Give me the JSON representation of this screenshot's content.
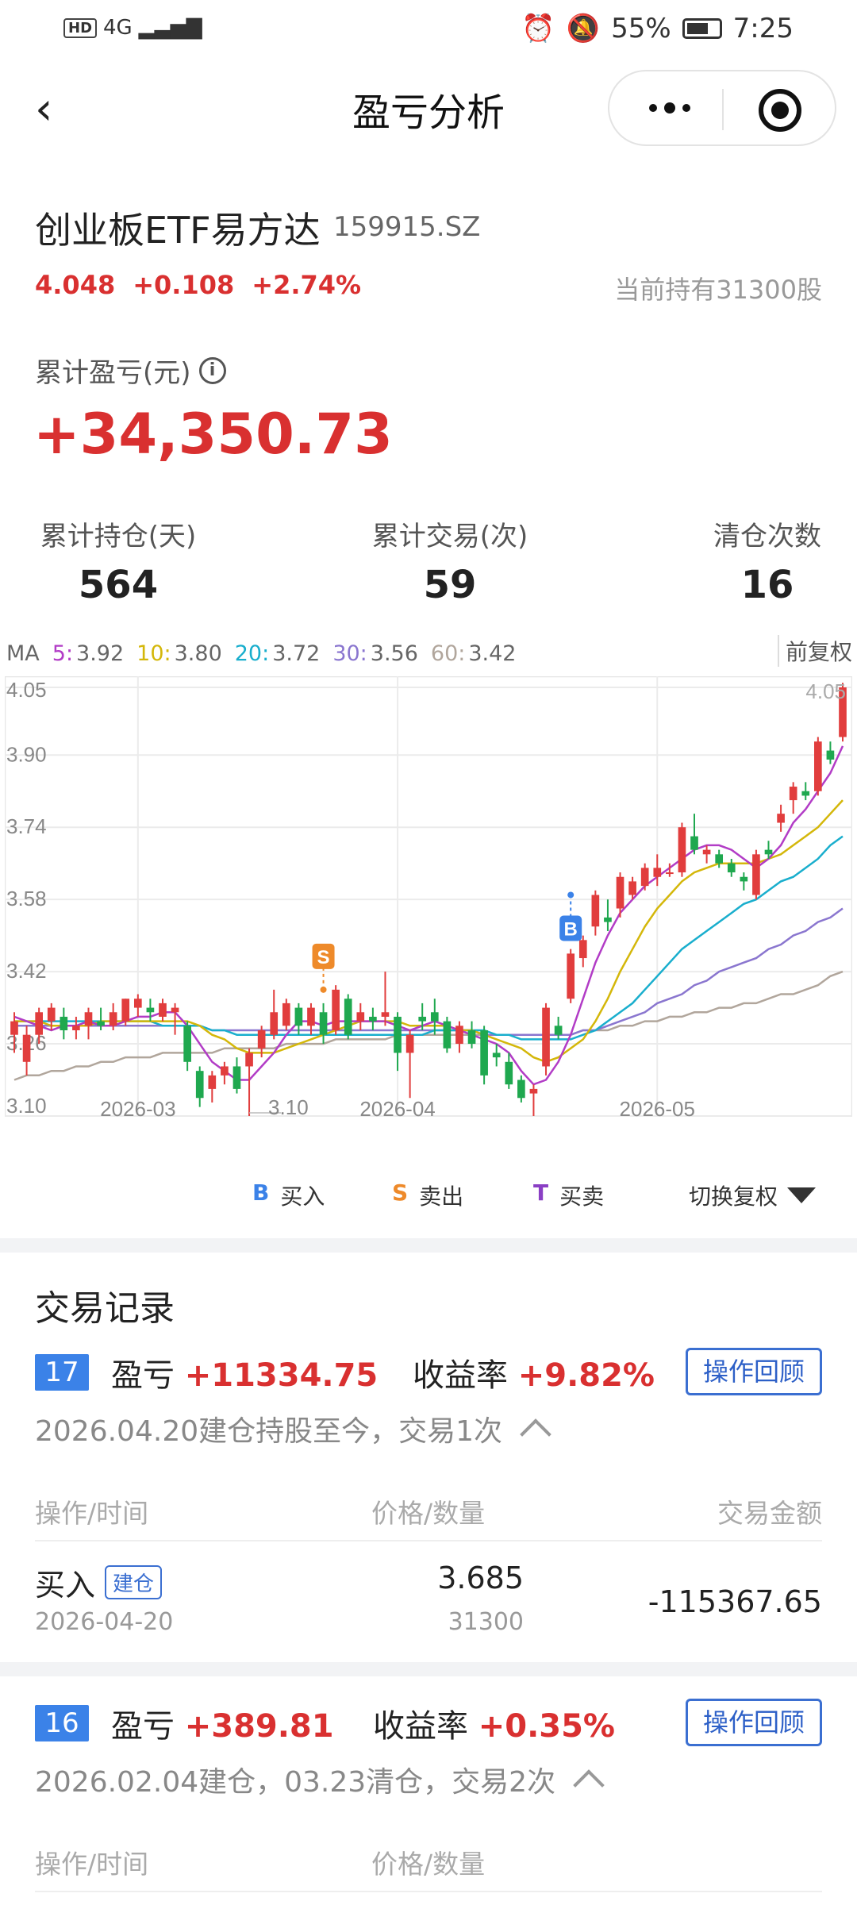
{
  "status_bar": {
    "hd": "HD",
    "network": "4G",
    "battery": "55%",
    "time": "7:25"
  },
  "nav": {
    "title": "盈亏分析",
    "back_icon": "chevron-left-icon",
    "more_icon": "more-dots-icon",
    "close_icon": "target-circle-icon"
  },
  "stock": {
    "name": "创业板ETF易方达",
    "code": "159915.SZ",
    "price": "4.048",
    "change": "+0.108",
    "change_pct": "+2.74%",
    "holding": "当前持有31300股"
  },
  "cumulative": {
    "label": "累计盈亏(元)",
    "value": "+34,350.73"
  },
  "stats": [
    {
      "label": "累计持仓(天)",
      "value": "564"
    },
    {
      "label": "累计交易(次)",
      "value": "59"
    },
    {
      "label": "清仓次数",
      "value": "16"
    }
  ],
  "ma": {
    "prefix": "MA",
    "items": [
      {
        "key": "5:",
        "value": "3.92",
        "color": "#b23cc6"
      },
      {
        "key": "10:",
        "value": "3.80",
        "color": "#d4b70a"
      },
      {
        "key": "20:",
        "value": "3.72",
        "color": "#19aecd"
      },
      {
        "key": "30:",
        "value": "3.56",
        "color": "#8a76cf"
      },
      {
        "key": "60:",
        "value": "3.42",
        "color": "#b1a69c"
      }
    ],
    "adjust_tag": "前复权"
  },
  "chart_data": {
    "type": "candlestick",
    "y_ticks": [
      "4.05",
      "3.90",
      "3.74",
      "3.58",
      "3.42",
      "3.26",
      "3.10"
    ],
    "ylim": [
      3.1,
      4.05
    ],
    "x_ticks": [
      "2026-03",
      "2026-04",
      "2026-05"
    ],
    "max_label": "4.05",
    "min_label": "3.10",
    "up_color": "#e13d3d",
    "down_color": "#1fa84f",
    "candles": [
      [
        3.28,
        3.31,
        3.25,
        3.24,
        3.33
      ],
      [
        3.22,
        3.28,
        3.21,
        3.19,
        3.3
      ],
      [
        3.28,
        3.33,
        3.27,
        3.26,
        3.34
      ],
      [
        3.31,
        3.34,
        3.3,
        3.29,
        3.35
      ],
      [
        3.32,
        3.29,
        3.33,
        3.27,
        3.34
      ],
      [
        3.29,
        3.3,
        3.28,
        3.27,
        3.32
      ],
      [
        3.3,
        3.33,
        3.28,
        3.27,
        3.34
      ],
      [
        3.31,
        3.3,
        3.33,
        3.29,
        3.34
      ],
      [
        3.3,
        3.33,
        3.3,
        3.29,
        3.35
      ],
      [
        3.31,
        3.36,
        3.3,
        3.3,
        3.36
      ],
      [
        3.34,
        3.36,
        3.33,
        3.32,
        3.37
      ],
      [
        3.34,
        3.33,
        3.35,
        3.31,
        3.36
      ],
      [
        3.32,
        3.35,
        3.32,
        3.31,
        3.36
      ],
      [
        3.33,
        3.34,
        3.29,
        3.28,
        3.35
      ],
      [
        3.3,
        3.22,
        3.3,
        3.2,
        3.31
      ],
      [
        3.2,
        3.14,
        3.2,
        3.12,
        3.21
      ],
      [
        3.16,
        3.19,
        3.15,
        3.13,
        3.2
      ],
      [
        3.19,
        3.21,
        3.18,
        3.17,
        3.22
      ],
      [
        3.21,
        3.16,
        3.21,
        3.15,
        3.23
      ],
      [
        3.21,
        3.24,
        3.2,
        3.1,
        3.25
      ],
      [
        3.25,
        3.29,
        3.24,
        3.23,
        3.3
      ],
      [
        3.28,
        3.33,
        3.28,
        3.27,
        3.38
      ],
      [
        3.3,
        3.35,
        3.3,
        3.29,
        3.36
      ],
      [
        3.34,
        3.3,
        3.34,
        3.28,
        3.35
      ],
      [
        3.3,
        3.34,
        3.29,
        3.28,
        3.35
      ],
      [
        3.33,
        3.28,
        3.33,
        3.26,
        3.35
      ],
      [
        3.29,
        3.38,
        3.29,
        3.28,
        3.39
      ],
      [
        3.36,
        3.28,
        3.36,
        3.27,
        3.37
      ],
      [
        3.31,
        3.33,
        3.3,
        3.29,
        3.35
      ],
      [
        3.32,
        3.31,
        3.33,
        3.29,
        3.34
      ],
      [
        3.32,
        3.33,
        3.31,
        3.3,
        3.42
      ],
      [
        3.32,
        3.24,
        3.32,
        3.2,
        3.33
      ],
      [
        3.24,
        3.28,
        3.23,
        3.14,
        3.29
      ],
      [
        3.32,
        3.31,
        3.33,
        3.29,
        3.35
      ],
      [
        3.33,
        3.31,
        3.33,
        3.28,
        3.36
      ],
      [
        3.31,
        3.25,
        3.31,
        3.24,
        3.32
      ],
      [
        3.26,
        3.3,
        3.25,
        3.24,
        3.31
      ],
      [
        3.29,
        3.26,
        3.29,
        3.25,
        3.31
      ],
      [
        3.29,
        3.19,
        3.29,
        3.17,
        3.3
      ],
      [
        3.24,
        3.23,
        3.25,
        3.21,
        3.26
      ],
      [
        3.22,
        3.17,
        3.22,
        3.16,
        3.24
      ],
      [
        3.18,
        3.14,
        3.18,
        3.13,
        3.19
      ],
      [
        3.15,
        3.16,
        3.14,
        3.1,
        3.17
      ],
      [
        3.21,
        3.34,
        3.2,
        3.19,
        3.35
      ],
      [
        3.3,
        3.28,
        3.31,
        3.27,
        3.32
      ],
      [
        3.36,
        3.46,
        3.36,
        3.35,
        3.47
      ],
      [
        3.45,
        3.49,
        3.44,
        3.43,
        3.5
      ],
      [
        3.52,
        3.59,
        3.51,
        3.5,
        3.6
      ],
      [
        3.54,
        3.53,
        3.57,
        3.51,
        3.58
      ],
      [
        3.56,
        3.63,
        3.55,
        3.54,
        3.64
      ],
      [
        3.59,
        3.62,
        3.59,
        3.58,
        3.63
      ],
      [
        3.61,
        3.65,
        3.6,
        3.6,
        3.66
      ],
      [
        3.63,
        3.65,
        3.62,
        3.61,
        3.68
      ],
      [
        3.64,
        3.64,
        3.62,
        3.63,
        3.66
      ],
      [
        3.64,
        3.74,
        3.64,
        3.63,
        3.75
      ],
      [
        3.72,
        3.69,
        3.73,
        3.68,
        3.77
      ],
      [
        3.68,
        3.69,
        3.67,
        3.66,
        3.7
      ],
      [
        3.68,
        3.66,
        3.67,
        3.65,
        3.69
      ],
      [
        3.66,
        3.64,
        3.66,
        3.63,
        3.67
      ],
      [
        3.63,
        3.62,
        3.63,
        3.6,
        3.64
      ],
      [
        3.59,
        3.68,
        3.59,
        3.58,
        3.69
      ],
      [
        3.69,
        3.68,
        3.7,
        3.67,
        3.71
      ],
      [
        3.75,
        3.77,
        3.74,
        3.73,
        3.79
      ],
      [
        3.8,
        3.83,
        3.79,
        3.77,
        3.84
      ],
      [
        3.82,
        3.81,
        3.82,
        3.8,
        3.84
      ],
      [
        3.82,
        3.93,
        3.82,
        3.81,
        3.94
      ],
      [
        3.91,
        3.89,
        3.91,
        3.88,
        3.93
      ],
      [
        3.94,
        4.05,
        3.94,
        3.93,
        4.06
      ]
    ],
    "ma_series": [
      {
        "name": "MA5",
        "color": "#b23cc6",
        "values": [
          3.32,
          3.31,
          3.3,
          3.29,
          3.3,
          3.3,
          3.31,
          3.3,
          3.3,
          3.31,
          3.32,
          3.32,
          3.33,
          3.33,
          3.3,
          3.26,
          3.22,
          3.2,
          3.18,
          3.18,
          3.21,
          3.24,
          3.28,
          3.31,
          3.31,
          3.3,
          3.31,
          3.31,
          3.31,
          3.31,
          3.31,
          3.3,
          3.29,
          3.3,
          3.31,
          3.3,
          3.29,
          3.28,
          3.27,
          3.26,
          3.24,
          3.2,
          3.17,
          3.18,
          3.22,
          3.28,
          3.36,
          3.44,
          3.5,
          3.55,
          3.58,
          3.61,
          3.63,
          3.65,
          3.67,
          3.69,
          3.7,
          3.7,
          3.69,
          3.67,
          3.65,
          3.67,
          3.7,
          3.75,
          3.78,
          3.82,
          3.86,
          3.92
        ]
      },
      {
        "name": "MA10",
        "color": "#d4b70a",
        "values": [
          3.31,
          3.31,
          3.31,
          3.3,
          3.3,
          3.3,
          3.3,
          3.31,
          3.31,
          3.31,
          3.31,
          3.31,
          3.31,
          3.31,
          3.31,
          3.3,
          3.28,
          3.27,
          3.25,
          3.24,
          3.24,
          3.24,
          3.25,
          3.26,
          3.27,
          3.28,
          3.29,
          3.3,
          3.31,
          3.31,
          3.31,
          3.31,
          3.3,
          3.3,
          3.3,
          3.3,
          3.29,
          3.29,
          3.28,
          3.27,
          3.26,
          3.25,
          3.23,
          3.22,
          3.23,
          3.25,
          3.27,
          3.31,
          3.36,
          3.42,
          3.47,
          3.52,
          3.56,
          3.59,
          3.62,
          3.64,
          3.65,
          3.66,
          3.66,
          3.66,
          3.66,
          3.67,
          3.68,
          3.7,
          3.72,
          3.74,
          3.77,
          3.8
        ]
      },
      {
        "name": "MA20",
        "color": "#19aecd",
        "values": [
          3.31,
          3.31,
          3.31,
          3.31,
          3.31,
          3.31,
          3.31,
          3.31,
          3.31,
          3.31,
          3.31,
          3.31,
          3.3,
          3.3,
          3.3,
          3.3,
          3.29,
          3.29,
          3.28,
          3.28,
          3.28,
          3.28,
          3.28,
          3.28,
          3.28,
          3.28,
          3.28,
          3.28,
          3.28,
          3.28,
          3.28,
          3.28,
          3.28,
          3.28,
          3.29,
          3.29,
          3.29,
          3.29,
          3.29,
          3.28,
          3.28,
          3.27,
          3.27,
          3.27,
          3.27,
          3.27,
          3.28,
          3.29,
          3.31,
          3.33,
          3.35,
          3.38,
          3.41,
          3.44,
          3.47,
          3.49,
          3.51,
          3.53,
          3.55,
          3.57,
          3.58,
          3.6,
          3.62,
          3.63,
          3.65,
          3.67,
          3.7,
          3.72
        ]
      },
      {
        "name": "MA30",
        "color": "#8a76cf",
        "values": [
          3.3,
          3.3,
          3.3,
          3.3,
          3.3,
          3.3,
          3.3,
          3.3,
          3.3,
          3.3,
          3.3,
          3.3,
          3.3,
          3.3,
          3.3,
          3.3,
          3.29,
          3.29,
          3.29,
          3.29,
          3.29,
          3.29,
          3.29,
          3.29,
          3.29,
          3.29,
          3.29,
          3.29,
          3.29,
          3.29,
          3.29,
          3.29,
          3.29,
          3.29,
          3.29,
          3.29,
          3.29,
          3.29,
          3.28,
          3.28,
          3.28,
          3.28,
          3.28,
          3.28,
          3.28,
          3.28,
          3.29,
          3.29,
          3.3,
          3.31,
          3.32,
          3.33,
          3.35,
          3.36,
          3.37,
          3.39,
          3.4,
          3.42,
          3.43,
          3.44,
          3.45,
          3.47,
          3.48,
          3.5,
          3.51,
          3.53,
          3.54,
          3.56
        ]
      },
      {
        "name": "MA60",
        "color": "#b1a69c",
        "values": [
          3.18,
          3.19,
          3.19,
          3.2,
          3.2,
          3.21,
          3.21,
          3.22,
          3.22,
          3.23,
          3.23,
          3.23,
          3.24,
          3.24,
          3.24,
          3.24,
          3.24,
          3.25,
          3.25,
          3.25,
          3.25,
          3.25,
          3.26,
          3.26,
          3.26,
          3.26,
          3.27,
          3.27,
          3.27,
          3.27,
          3.27,
          3.28,
          3.28,
          3.28,
          3.28,
          3.28,
          3.28,
          3.28,
          3.28,
          3.28,
          3.28,
          3.28,
          3.28,
          3.28,
          3.28,
          3.28,
          3.29,
          3.29,
          3.29,
          3.3,
          3.3,
          3.31,
          3.31,
          3.32,
          3.32,
          3.33,
          3.33,
          3.34,
          3.34,
          3.35,
          3.35,
          3.36,
          3.37,
          3.37,
          3.38,
          3.39,
          3.41,
          3.42
        ]
      }
    ],
    "markers": [
      {
        "label": "S",
        "index": 25,
        "value": 3.38,
        "position": "above",
        "color": "#ee8a2a"
      },
      {
        "label": "B",
        "index": 45,
        "value": 3.59,
        "position": "below",
        "color": "#3b82e8"
      }
    ]
  },
  "legend": {
    "items": [
      {
        "letter": "B",
        "text": "买入",
        "color": "#3b82e8"
      },
      {
        "letter": "S",
        "text": "卖出",
        "color": "#ee8a2a"
      },
      {
        "letter": "T",
        "text": "买卖",
        "color": "#8a3fc4"
      }
    ],
    "switch_label": "切换复权"
  },
  "records": {
    "title": "交易记录",
    "table_headers": [
      "操作/时间",
      "价格/数量",
      "交易金额"
    ],
    "items": [
      {
        "num": "17",
        "pl_label": "盈亏",
        "pl_value": "+11334.75",
        "rate_label": "收益率",
        "rate_value": "+9.82%",
        "review": "操作回顾",
        "summary": "2026.04.20建仓持股至今，交易1次",
        "trades": [
          {
            "op": "买入",
            "tag": "建仓",
            "date": "2026-04-20",
            "price": "3.685",
            "qty": "31300",
            "amount": "-115367.65"
          }
        ]
      },
      {
        "num": "16",
        "pl_label": "盈亏",
        "pl_value": "+389.81",
        "rate_label": "收益率",
        "rate_value": "+0.35%",
        "review": "操作回顾",
        "summary": "2026.02.04建仓，03.23清仓，交易2次"
      }
    ]
  }
}
